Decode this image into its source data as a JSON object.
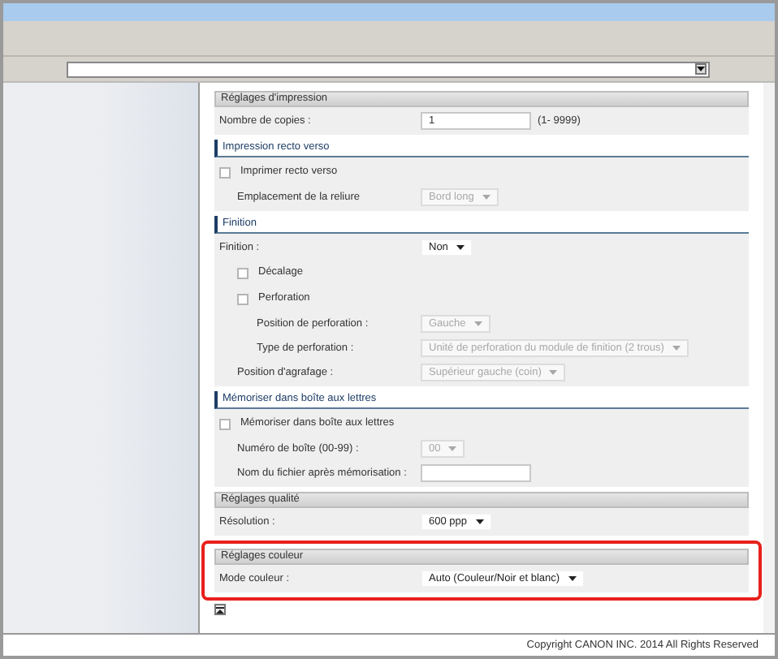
{
  "sections": [
    {
      "title": "Réglages d'impression",
      "kind": "bar",
      "highlighted": false,
      "rows": [
        {
          "kind": "input",
          "label": "Nombre de copies :",
          "value": "1",
          "hint": "(1- 9999)"
        }
      ]
    },
    {
      "title": "Impression recto verso",
      "kind": "line",
      "highlighted": false,
      "rows": [
        {
          "kind": "checkbox",
          "label": "Imprimer recto verso",
          "checked": false,
          "children": [
            {
              "kind": "select",
              "label": "Emplacement de la reliure",
              "value": "Bord long",
              "disabled": true
            }
          ]
        }
      ]
    },
    {
      "title": "Finition",
      "kind": "line",
      "highlighted": false,
      "rows": [
        {
          "kind": "select",
          "label": "Finition :",
          "value": "Non",
          "disabled": false,
          "children": [
            {
              "kind": "checkbox",
              "label": "Décalage",
              "checked": false
            },
            {
              "kind": "checkbox",
              "label": "Perforation",
              "checked": false,
              "children": [
                {
                  "kind": "select",
                  "label": "Position de perforation :",
                  "value": "Gauche",
                  "disabled": true
                },
                {
                  "kind": "select",
                  "label": "Type de perforation :",
                  "value": "Unité de perforation du module de finition (2 trous)",
                  "disabled": true
                }
              ]
            },
            {
              "kind": "select",
              "label": "Position d'agrafage :",
              "value": "Supérieur gauche (coin)",
              "disabled": true
            }
          ]
        }
      ]
    },
    {
      "title": "Mémoriser dans boîte aux lettres",
      "kind": "line",
      "highlighted": false,
      "rows": [
        {
          "kind": "checkbox",
          "label": "Mémoriser dans boîte aux lettres",
          "checked": false,
          "children": [
            {
              "kind": "select",
              "label": "Numéro de boîte (00-99) :",
              "value": "00",
              "disabled": true
            },
            {
              "kind": "input",
              "label": "Nom du fichier après mémorisation :"
            }
          ]
        }
      ]
    },
    {
      "title": "Réglages qualité",
      "kind": "bar",
      "highlighted": false,
      "rows": [
        {
          "kind": "select",
          "label": "Résolution :",
          "value": "600 ppp",
          "disabled": false
        }
      ]
    },
    {
      "title": "Réglages couleur",
      "kind": "bar",
      "highlighted": true,
      "rows": [
        {
          "kind": "select",
          "label": "Mode couleur :",
          "value": "Auto (Couleur/Noir et blanc)",
          "disabled": false
        }
      ]
    }
  ],
  "footer": "Copyright CANON INC. 2014 All Rights Reserved"
}
